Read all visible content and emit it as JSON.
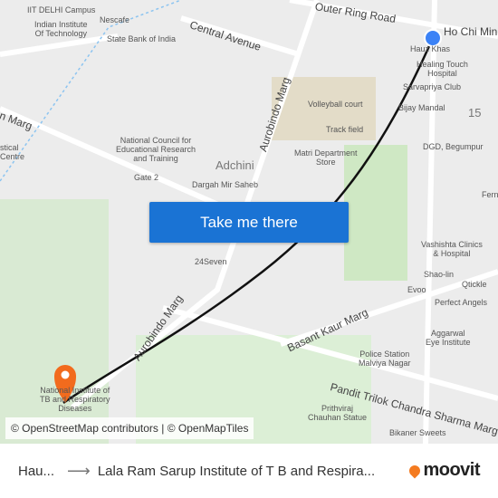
{
  "map": {
    "labels": [
      "IIT DELHI Campus",
      "Nescafe",
      "Indian Institute\nOf Technology",
      "State Bank of India",
      "Hauz Khas",
      "Healing Touch\nHospital",
      "Sarvapriya Club",
      "Volleyball court",
      "Bijay Mandal",
      "Track field",
      "15",
      "DGD, Begumpur",
      "National Council for\nEducational Research\nand Training",
      "Adchini",
      "Matri Department\nStore",
      "Dargah Mir Saheb",
      "Gate 2",
      "24Seven",
      "Vashishta Clinics\n& Hospital",
      "Shao-lin",
      "Qtickle",
      "Evoo",
      "Perfect Angels",
      "Aggarwal\nEye Institute",
      "Police Station\nMalviya Nagar",
      "Prithviraj\nChauhan Statue",
      "Bikaner Sweets",
      "National Institute of\nTB and Respiratory\nDiseases",
      "Fern",
      "stical\nCentre"
    ],
    "roads": [
      "Outer Ring Road",
      "Ho Chi Minh",
      "Central Avenue",
      "Aurobindo Marg",
      "Aurobindo Marg",
      "Basant Kaur Marg",
      "Pandit Trilok Chandra Sharma Marg",
      "n Marg"
    ],
    "origin_color": "#3b82f6",
    "destination_color": "#f26b1d",
    "route_color": "#111111"
  },
  "cta": {
    "label": "Take me there"
  },
  "attribution": "© OpenStreetMap contributors | © OpenMapTiles",
  "footer": {
    "from": "Hau...",
    "to": "Lala Ram Sarup Institute of T B and Respira...",
    "brand": "moovit",
    "brand_color": "#f47b20"
  }
}
